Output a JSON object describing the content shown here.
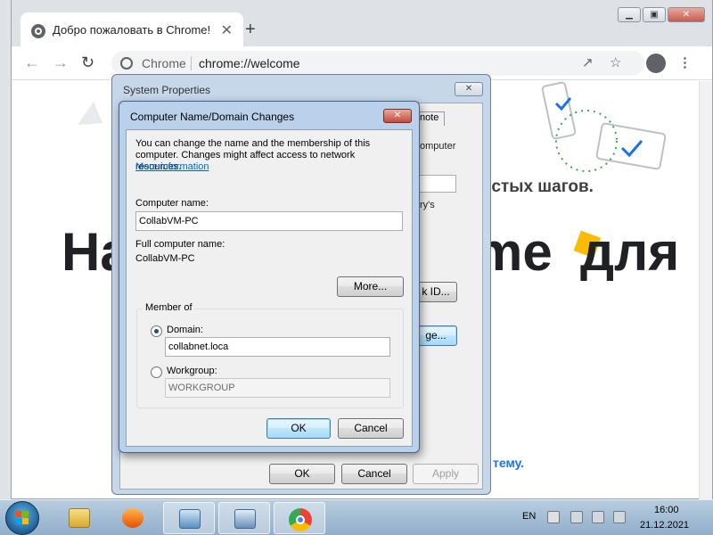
{
  "browser": {
    "tab_title": "Добро пожаловать в Chrome!",
    "tab_close": "✕",
    "new_tab": "+",
    "omnibox_site": "Chrome",
    "omnibox_url": "chrome://welcome",
    "window_buttons": [
      "▁",
      "▣",
      "✕"
    ],
    "page": {
      "headline_left": "На",
      "headline_right": "me",
      "headline_right2": "для",
      "steps_fragment": "остых шагов.",
      "bottom_link_fragment": "тему."
    }
  },
  "system_properties": {
    "title": "System Properties",
    "close": "✕",
    "tab_fragment": "note",
    "text_fragments": [
      "omputer",
      "ry's"
    ],
    "buttons": {
      "network_id_fragment": "k ID...",
      "change_fragment": "ge...",
      "ok": "OK",
      "cancel": "Cancel",
      "apply": "Apply"
    }
  },
  "computer_name_dialog": {
    "title": "Computer Name/Domain Changes",
    "close": "✕",
    "intro": "You can change the name and the membership of this computer. Changes might affect access to network resources.",
    "more_info_link": "More information",
    "computer_name_label": "Computer name:",
    "computer_name_value": "CollabVM-PC",
    "full_name_label": "Full computer name:",
    "full_name_value": "CollabVM-PC",
    "more_button": "More...",
    "member_of": {
      "legend": "Member of",
      "domain_label": "Domain:",
      "domain_value": "collabnet.loca",
      "domain_selected": true,
      "workgroup_label": "Workgroup:",
      "workgroup_value": "WORKGROUP"
    },
    "ok_button": "OK",
    "cancel_button": "Cancel"
  },
  "taskbar": {
    "language": "EN",
    "time": "16:00",
    "date": "21.12.2021"
  },
  "colors": {
    "accent_blue": "#1a73e8",
    "yellow": "#fbbc04",
    "dialog_frame": "#b9d1ea"
  }
}
